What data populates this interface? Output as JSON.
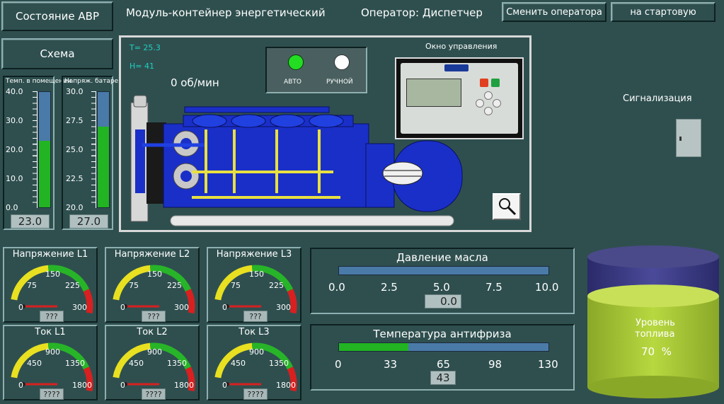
{
  "nav": {
    "avr_status": "Состояние АВР",
    "scheme": "Схема"
  },
  "header": {
    "title": "Модуль-контейнер энергетический",
    "operator": "Оператор: Диспетчер",
    "change_operator": "Сменить оператора",
    "to_start": "на стартовую"
  },
  "vbar_temp": {
    "label": "Темп. в помещении",
    "ticks": [
      "40.0",
      "30.0",
      "20.0",
      "10.0",
      "0.0"
    ],
    "value": "23.0",
    "level": 0.575
  },
  "vbar_batt": {
    "label": "Напряж. батареи",
    "ticks": [
      "30.0",
      "27.5",
      "25.0",
      "22.5",
      "20.0"
    ],
    "value": "27.0",
    "level": 0.7
  },
  "engine": {
    "temp": "T=  25.3",
    "humidity": "H=  41",
    "rpm": "0   об/мин"
  },
  "mode": {
    "auto": "АВТО",
    "manual": "РУЧНОЙ"
  },
  "control": {
    "title": "Окно управления"
  },
  "alarm": {
    "title": "Сигнализация"
  },
  "gauges_voltage": [
    {
      "title": "Напряжение L1",
      "value": "???",
      "labels": [
        "0",
        "75",
        "150",
        "225",
        "300"
      ]
    },
    {
      "title": "Напряжение L2",
      "value": "???",
      "labels": [
        "0",
        "75",
        "150",
        "225",
        "300"
      ]
    },
    {
      "title": "Напряжение L3",
      "value": "???",
      "labels": [
        "0",
        "75",
        "150",
        "225",
        "300"
      ]
    }
  ],
  "gauges_current": [
    {
      "title": "Ток L1",
      "value": "????",
      "labels": [
        "0",
        "450",
        "900",
        "1350",
        "1800"
      ]
    },
    {
      "title": "Ток L2",
      "value": "????",
      "labels": [
        "0",
        "450",
        "900",
        "1350",
        "1800"
      ]
    },
    {
      "title": "Ток L3",
      "value": "????",
      "labels": [
        "0",
        "450",
        "900",
        "1350",
        "1800"
      ]
    }
  ],
  "oil": {
    "title": "Давление масла",
    "ticks": [
      "0.0",
      "2.5",
      "5.0",
      "7.5",
      "10.0"
    ],
    "value": "0.0",
    "level": 0.0
  },
  "coolant": {
    "title": "Температура антифриза",
    "ticks": [
      "0",
      "33",
      "65",
      "98",
      "130"
    ],
    "value": "43",
    "level": 0.33
  },
  "fuel": {
    "title_1": "Уровень",
    "title_2": "топлива",
    "value": "70  %",
    "level": 0.7
  },
  "colors": {
    "bg": "#2f4f4f",
    "engine_blue": "#1a2fc8",
    "bar_green": "#22b422",
    "bar_blue": "#4a7aa8",
    "tank_green": "#a8c838",
    "tank_purple": "#3a3a7a"
  }
}
